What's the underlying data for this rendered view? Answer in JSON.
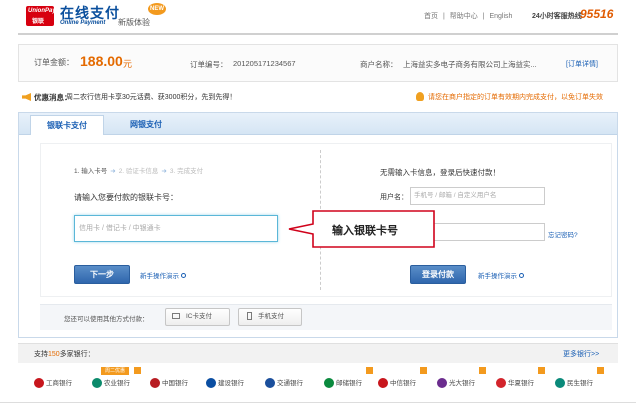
{
  "header": {
    "logo_brand": "UnionPay",
    "logo_brand_cn": "银联",
    "title": "在线支付",
    "subtitle": "Online Payment",
    "version_label": "新版体验",
    "new_badge": "NEW",
    "links": [
      "首页",
      "|",
      "帮助中心",
      "|",
      "English"
    ],
    "hotline_label": "24小时客服热线",
    "hotline_number": "95516"
  },
  "order": {
    "amount_label": "订单金额：",
    "amount_value": "188.00",
    "amount_unit": "元",
    "order_no_label": "订单编号：",
    "order_no_value": "201205171234567",
    "merchant_label": "商户名称：",
    "merchant_value": "上海益实多电子商务有限公司上海益实...",
    "detail_link": "订单详情"
  },
  "promo": {
    "label": "优惠消息：",
    "text": "周二农行信用卡享30元话费、获3000积分，先到先得！",
    "tip": "请您在商户指定的订单有效期内完成支付，以免订单失效"
  },
  "tabs": [
    "银联卡支付",
    "网银支付"
  ],
  "card_pay": {
    "steps": [
      "1. 输入卡号",
      "2. 验证卡信息",
      "3. 完成支付"
    ],
    "prompt": "请输入您要付款的银联卡号：",
    "input_placeholder": "信用卡 / 借记卡 / 中银通卡",
    "next_button": "下一步",
    "demo_link": "新手操作演示"
  },
  "login_pay": {
    "title": "无需输入卡信息，登录后快速付款！",
    "username_label": "用户名：",
    "username_placeholder": "手机号 / 邮箱 / 自定义用户名",
    "forgot_password": "忘记密码?",
    "login_button": "登录付款",
    "demo_link": "新手操作演示"
  },
  "callout": {
    "text": "输入银联卡号"
  },
  "other_methods": {
    "text": "您还可以使用其他方式付款：",
    "ic_button": "IC卡支付",
    "mobile_button": "手机支付"
  },
  "banks": {
    "title_prefix": "支持",
    "count": "150",
    "title_suffix": "多家银行：",
    "more": "更多银行>>",
    "promo_badge": "周二优惠",
    "items": [
      {
        "name": "工商银行",
        "color": "#c7161d"
      },
      {
        "name": "农业银行",
        "color": "#0b8a6b"
      },
      {
        "name": "中国银行",
        "color": "#b81c22"
      },
      {
        "name": "建设银行",
        "color": "#0a4ea2"
      },
      {
        "name": "交通银行",
        "color": "#1b4f9c"
      },
      {
        "name": "邮储银行",
        "color": "#0a8a3e"
      },
      {
        "name": "中信银行",
        "color": "#c8161d"
      },
      {
        "name": "光大银行",
        "color": "#6b2c8e"
      },
      {
        "name": "华夏银行",
        "color": "#d3242b"
      },
      {
        "name": "民生银行",
        "color": "#0a8a7a"
      }
    ]
  }
}
